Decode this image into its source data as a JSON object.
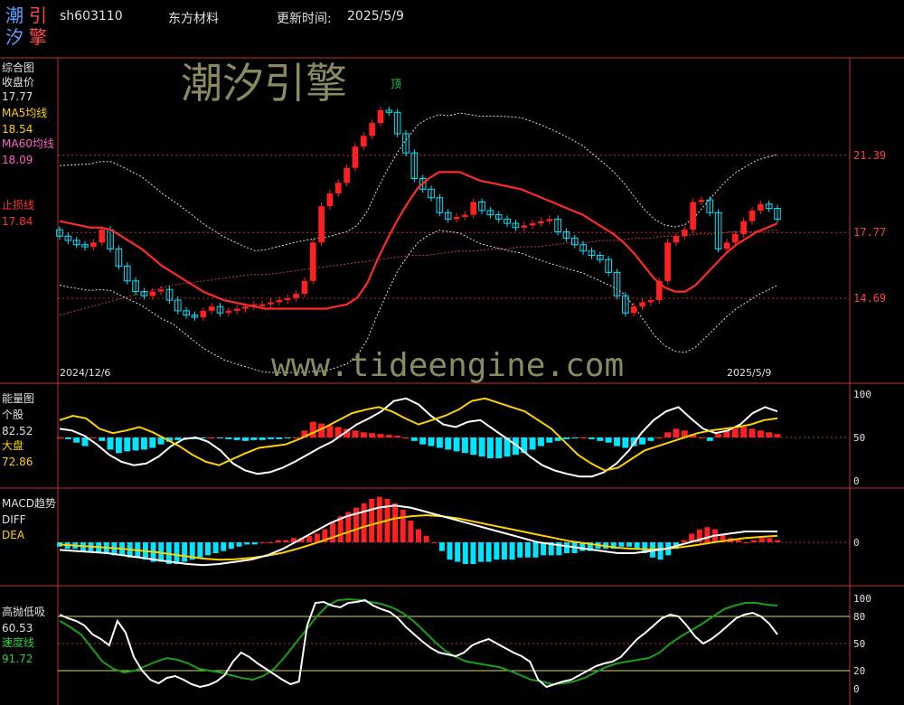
{
  "header": {
    "logo_chars": [
      "潮",
      "引",
      "汐",
      "擎"
    ],
    "code": "sh603110",
    "name": "东方材料",
    "update_label": "更新时间:",
    "update_date": "2025/5/9"
  },
  "watermark": {
    "brand": "潮汐引擎",
    "url": "www.tideengine.com"
  },
  "panel_main": {
    "title": "综合图",
    "close_label": "收盘价",
    "close_value": "17.77",
    "ma5_label": "MA5均线",
    "ma5_value": "18.54",
    "ma60_label": "MA60均线",
    "ma60_value": "18.09",
    "stop_label": "止损线",
    "stop_value": "17.84",
    "top_marker": "顶",
    "start_date": "2024/12/6",
    "end_date": "2025/5/9"
  },
  "panel_energy": {
    "title": "能量图",
    "stock_label": "个股",
    "stock_value": "82.52",
    "market_label": "大盘",
    "market_value": "72.86"
  },
  "panel_macd": {
    "title": "MACD趋势",
    "diff_label": "DIFF",
    "dea_label": "DEA"
  },
  "panel_osc": {
    "title": "高抛低吸",
    "value": "60.53",
    "speed_label": "速度线",
    "speed_value": "91.72"
  },
  "colors": {
    "up": "#ff2020",
    "down": "#00e5ff",
    "grid": "#c03030",
    "ma": "#ff2a2a",
    "ma60": "#c04040",
    "yellow": "#ffd200",
    "green": "#18a018"
  },
  "chart_data": [
    {
      "type": "candlestick",
      "title": "综合图",
      "x_range": [
        "2024/12/6",
        "2025/5/9"
      ],
      "yticks": [
        21.39,
        17.77,
        14.69
      ],
      "close": [
        17.6,
        17.4,
        17.2,
        17.1,
        17.3,
        17.9,
        17.0,
        16.2,
        15.5,
        15.0,
        14.8,
        15.0,
        15.1,
        14.6,
        14.1,
        13.9,
        13.8,
        14.1,
        14.3,
        14.0,
        14.1,
        14.2,
        14.3,
        14.4,
        14.4,
        14.5,
        14.6,
        14.7,
        14.9,
        15.5,
        17.3,
        19.0,
        19.6,
        20.1,
        20.8,
        21.8,
        22.3,
        22.9,
        23.5,
        23.4,
        22.4,
        21.5,
        20.3,
        19.8,
        19.4,
        18.7,
        18.4,
        18.5,
        18.6,
        19.2,
        18.8,
        18.6,
        18.4,
        18.2,
        18.0,
        18.1,
        18.2,
        18.3,
        18.4,
        17.8,
        17.5,
        17.2,
        16.9,
        16.7,
        16.5,
        15.9,
        14.8,
        14.0,
        14.3,
        14.5,
        14.6,
        15.5,
        17.3,
        17.6,
        17.9,
        19.2,
        19.3,
        18.7,
        17.0,
        17.3,
        17.7,
        18.3,
        18.8,
        19.1,
        18.9,
        18.4
      ],
      "ma5": [
        18.3,
        18.2,
        18.1,
        18.0,
        18.0,
        17.9,
        17.6,
        17.3,
        17.0,
        16.6,
        16.2,
        15.9,
        15.6,
        15.3,
        15.0,
        14.8,
        14.6,
        14.5,
        14.4,
        14.3,
        14.2,
        14.2,
        14.2,
        14.2,
        14.2,
        14.2,
        14.2,
        14.3,
        14.4,
        14.7,
        15.4,
        16.5,
        17.5,
        18.4,
        19.2,
        19.9,
        20.3,
        20.6,
        20.6,
        20.6,
        20.4,
        20.2,
        20.1,
        20.0,
        19.9,
        19.8,
        19.6,
        19.4,
        19.2,
        19.0,
        18.8,
        18.6,
        18.3,
        18.0,
        17.7,
        17.3,
        16.8,
        16.2,
        15.6,
        15.2,
        15.0,
        15.0,
        15.3,
        15.8,
        16.3,
        16.8,
        17.2,
        17.5,
        17.8,
        18.0,
        18.2
      ],
      "ma60": [
        13.9,
        14.1,
        14.3,
        14.5,
        14.7,
        14.9,
        15.1,
        15.3,
        15.4,
        15.5,
        15.6,
        15.7,
        15.8,
        15.8,
        15.9,
        16.0,
        16.1,
        16.2,
        16.3,
        16.4,
        16.5,
        16.6,
        16.7,
        16.7,
        16.8,
        16.9,
        16.9,
        17.0,
        17.0,
        17.1,
        17.1,
        17.2,
        17.3,
        17.3,
        17.4,
        17.4,
        17.5,
        17.5,
        17.6,
        17.6,
        17.7,
        17.7,
        17.8,
        17.8,
        17.8,
        17.9
      ]
    },
    {
      "type": "bar+line",
      "title": "能量图",
      "ylim": [
        0,
        100
      ],
      "yticks": [
        0,
        50,
        100
      ],
      "bars": [
        0,
        -2,
        -6,
        -10,
        0,
        -4,
        -14,
        -18,
        -16,
        -15,
        -14,
        -12,
        -8,
        -5,
        -3,
        -2,
        -2,
        -1,
        0,
        -1,
        -2,
        -3,
        -4,
        -3,
        -3,
        -2,
        -2,
        -1,
        0,
        8,
        18,
        16,
        14,
        12,
        10,
        8,
        6,
        5,
        4,
        3,
        2,
        0,
        -4,
        -8,
        -10,
        -12,
        -14,
        -16,
        -18,
        -20,
        -22,
        -24,
        -24,
        -22,
        -20,
        -18,
        -14,
        -10,
        -6,
        -4,
        -2,
        -1,
        0,
        -2,
        -4,
        -6,
        -10,
        -12,
        -10,
        -8,
        -4,
        0,
        6,
        10,
        8,
        4,
        0,
        -4,
        4,
        8,
        10,
        12,
        10,
        8,
        6,
        4
      ],
      "stock": [
        60,
        58,
        52,
        42,
        30,
        22,
        18,
        20,
        28,
        40,
        48,
        50,
        45,
        35,
        20,
        12,
        8,
        10,
        15,
        22,
        30,
        38,
        45,
        55,
        65,
        72,
        80,
        92,
        95,
        88,
        75,
        65,
        62,
        68,
        70,
        60,
        50,
        40,
        28,
        18,
        12,
        8,
        5,
        5,
        10,
        20,
        35,
        55,
        70,
        80,
        85,
        72,
        60,
        55,
        58,
        65,
        78,
        85,
        80
      ],
      "market": [
        70,
        75,
        72,
        60,
        55,
        58,
        62,
        56,
        48,
        40,
        30,
        22,
        18,
        25,
        32,
        38,
        40,
        42,
        48,
        55,
        62,
        70,
        78,
        82,
        85,
        80,
        72,
        65,
        70,
        75,
        82,
        92,
        95,
        90,
        85,
        80,
        70,
        60,
        45,
        30,
        20,
        12,
        15,
        25,
        35,
        40,
        45,
        50,
        55,
        58,
        60,
        62,
        65,
        70,
        72
      ]
    },
    {
      "type": "bar+line",
      "title": "MACD趋势",
      "yticks": [
        0
      ],
      "hist": [
        -2,
        -3,
        -3,
        -4,
        -4,
        -5,
        -5,
        -6,
        -6,
        -7,
        -7,
        -8,
        -9,
        -9,
        -10,
        -10,
        -9,
        -8,
        -7,
        -6,
        -5,
        -4,
        -3,
        -2,
        -1,
        -1,
        0,
        0,
        1,
        1,
        2,
        2,
        3,
        4,
        6,
        9,
        12,
        14,
        16,
        18,
        20,
        21,
        20,
        18,
        15,
        10,
        6,
        3,
        0,
        -4,
        -8,
        -9,
        -10,
        -10,
        -9,
        -9,
        -8,
        -8,
        -8,
        -7,
        -7,
        -7,
        -6,
        -6,
        -6,
        -5,
        -5,
        -4,
        -4,
        -3,
        -3,
        -3,
        -2,
        -2,
        -3,
        -5,
        -7,
        -8,
        -6,
        -3,
        1,
        4,
        6,
        7,
        6,
        4,
        2,
        1,
        0,
        1,
        2,
        2,
        1
      ],
      "diff": [
        -3.5,
        -4,
        -4.5,
        -5,
        -6,
        -7,
        -8,
        -9,
        -10,
        -10.5,
        -10,
        -9,
        -8,
        -6,
        -3,
        1,
        5,
        9,
        12,
        14,
        16,
        17,
        16,
        14,
        12,
        10,
        8,
        6,
        4,
        2,
        0,
        -1,
        -2,
        -3,
        -4,
        -5,
        -5,
        -4,
        -3,
        -1,
        1,
        3,
        4,
        5,
        5,
        5
      ],
      "dea": [
        -1,
        -1.5,
        -2,
        -2.5,
        -3,
        -3.8,
        -4.5,
        -5.5,
        -6.5,
        -7.5,
        -8,
        -7.8,
        -7.2,
        -6.2,
        -4.8,
        -2.8,
        -0.5,
        2,
        4.5,
        7,
        9,
        11,
        12,
        12.5,
        12,
        11,
        9.5,
        8,
        6.5,
        5,
        3.5,
        2,
        0.5,
        -0.5,
        -1.5,
        -2.5,
        -3,
        -3.2,
        -3,
        -2.2,
        -1.2,
        0,
        1,
        2,
        2.5,
        3
      ]
    },
    {
      "type": "line",
      "title": "高抛低吸",
      "ylim": [
        0,
        100
      ],
      "yticks": [
        0,
        20,
        50,
        80,
        100
      ],
      "hlines": [
        20,
        50,
        80
      ],
      "white": [
        82,
        78,
        75,
        70,
        60,
        55,
        48,
        75,
        62,
        35,
        20,
        10,
        6,
        12,
        14,
        10,
        5,
        2,
        4,
        8,
        15,
        30,
        40,
        35,
        28,
        22,
        16,
        10,
        5,
        8,
        70,
        95,
        96,
        92,
        90,
        95,
        96,
        98,
        92,
        88,
        85,
        78,
        68,
        60,
        52,
        45,
        40,
        38,
        36,
        40,
        48,
        52,
        55,
        50,
        45,
        40,
        36,
        30,
        10,
        2,
        5,
        8,
        10,
        15,
        20,
        25,
        28,
        30,
        35,
        45,
        55,
        62,
        70,
        78,
        82,
        80,
        70,
        58,
        50,
        55,
        62,
        70,
        78,
        82,
        84,
        80,
        72,
        60
      ],
      "green": [
        75,
        68,
        60,
        45,
        30,
        22,
        18,
        20,
        25,
        30,
        34,
        32,
        28,
        22,
        20,
        18,
        15,
        12,
        10,
        14,
        22,
        35,
        50,
        65,
        80,
        92,
        98,
        99,
        98,
        96,
        94,
        90,
        84,
        75,
        64,
        52,
        42,
        35,
        30,
        28,
        26,
        24,
        20,
        15,
        10,
        8,
        5,
        6,
        8,
        12,
        18,
        24,
        28,
        30,
        32,
        34,
        40,
        50,
        58,
        65,
        72,
        80,
        88,
        92,
        95,
        95,
        93,
        92
      ]
    }
  ]
}
